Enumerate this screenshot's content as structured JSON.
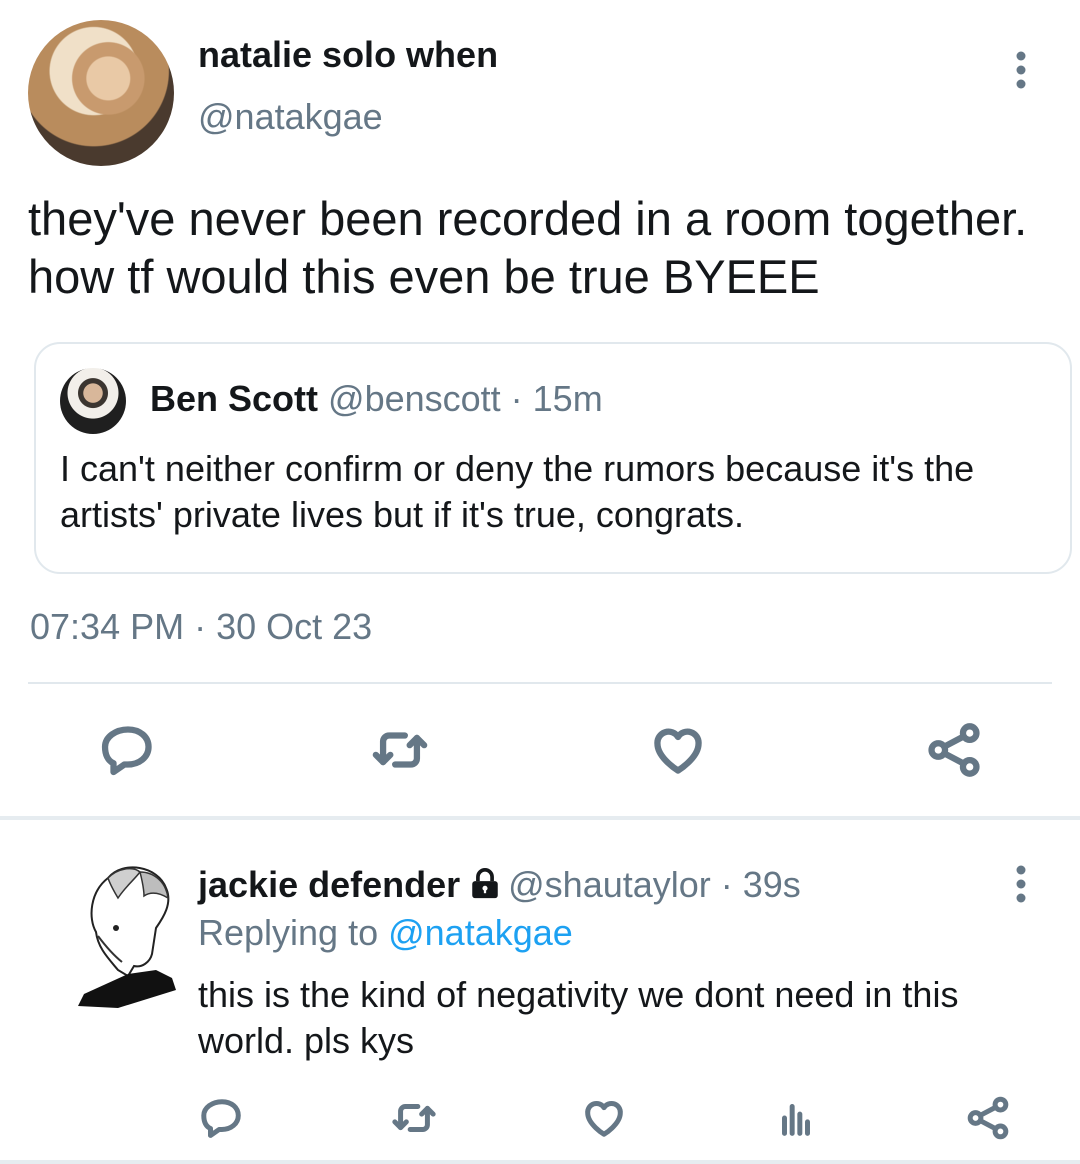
{
  "tweet": {
    "display_name": "natalie solo when",
    "handle": "@natakgae",
    "text": "they've never been recorded in a room together. how tf would this even be true BYEEE",
    "timestamp": "07:34 PM · 30 Oct 23",
    "quote": {
      "name": "Ben Scott",
      "handle": "@benscott",
      "time": " · 15m",
      "text": "I can't neither confirm or deny the rumors because it's the artists' private lives but if it's true, congrats."
    },
    "actions": [
      "reply-icon",
      "retweet-icon",
      "like-icon",
      "share-icon"
    ]
  },
  "reply": {
    "name": "jackie defender",
    "handle": "@shautaylor",
    "time": " · 39s",
    "replying_prefix": "Replying to ",
    "replying_mention": "@natakgae",
    "text": "this is the kind of negativity we dont need in this world. pls kys",
    "actions": [
      "reply-icon",
      "retweet-icon",
      "like-icon",
      "analytics-icon",
      "share-icon"
    ]
  },
  "colors": {
    "text": "#14171a",
    "secondary": "#657786",
    "link": "#1da1f2",
    "border": "#e1e8ed"
  }
}
